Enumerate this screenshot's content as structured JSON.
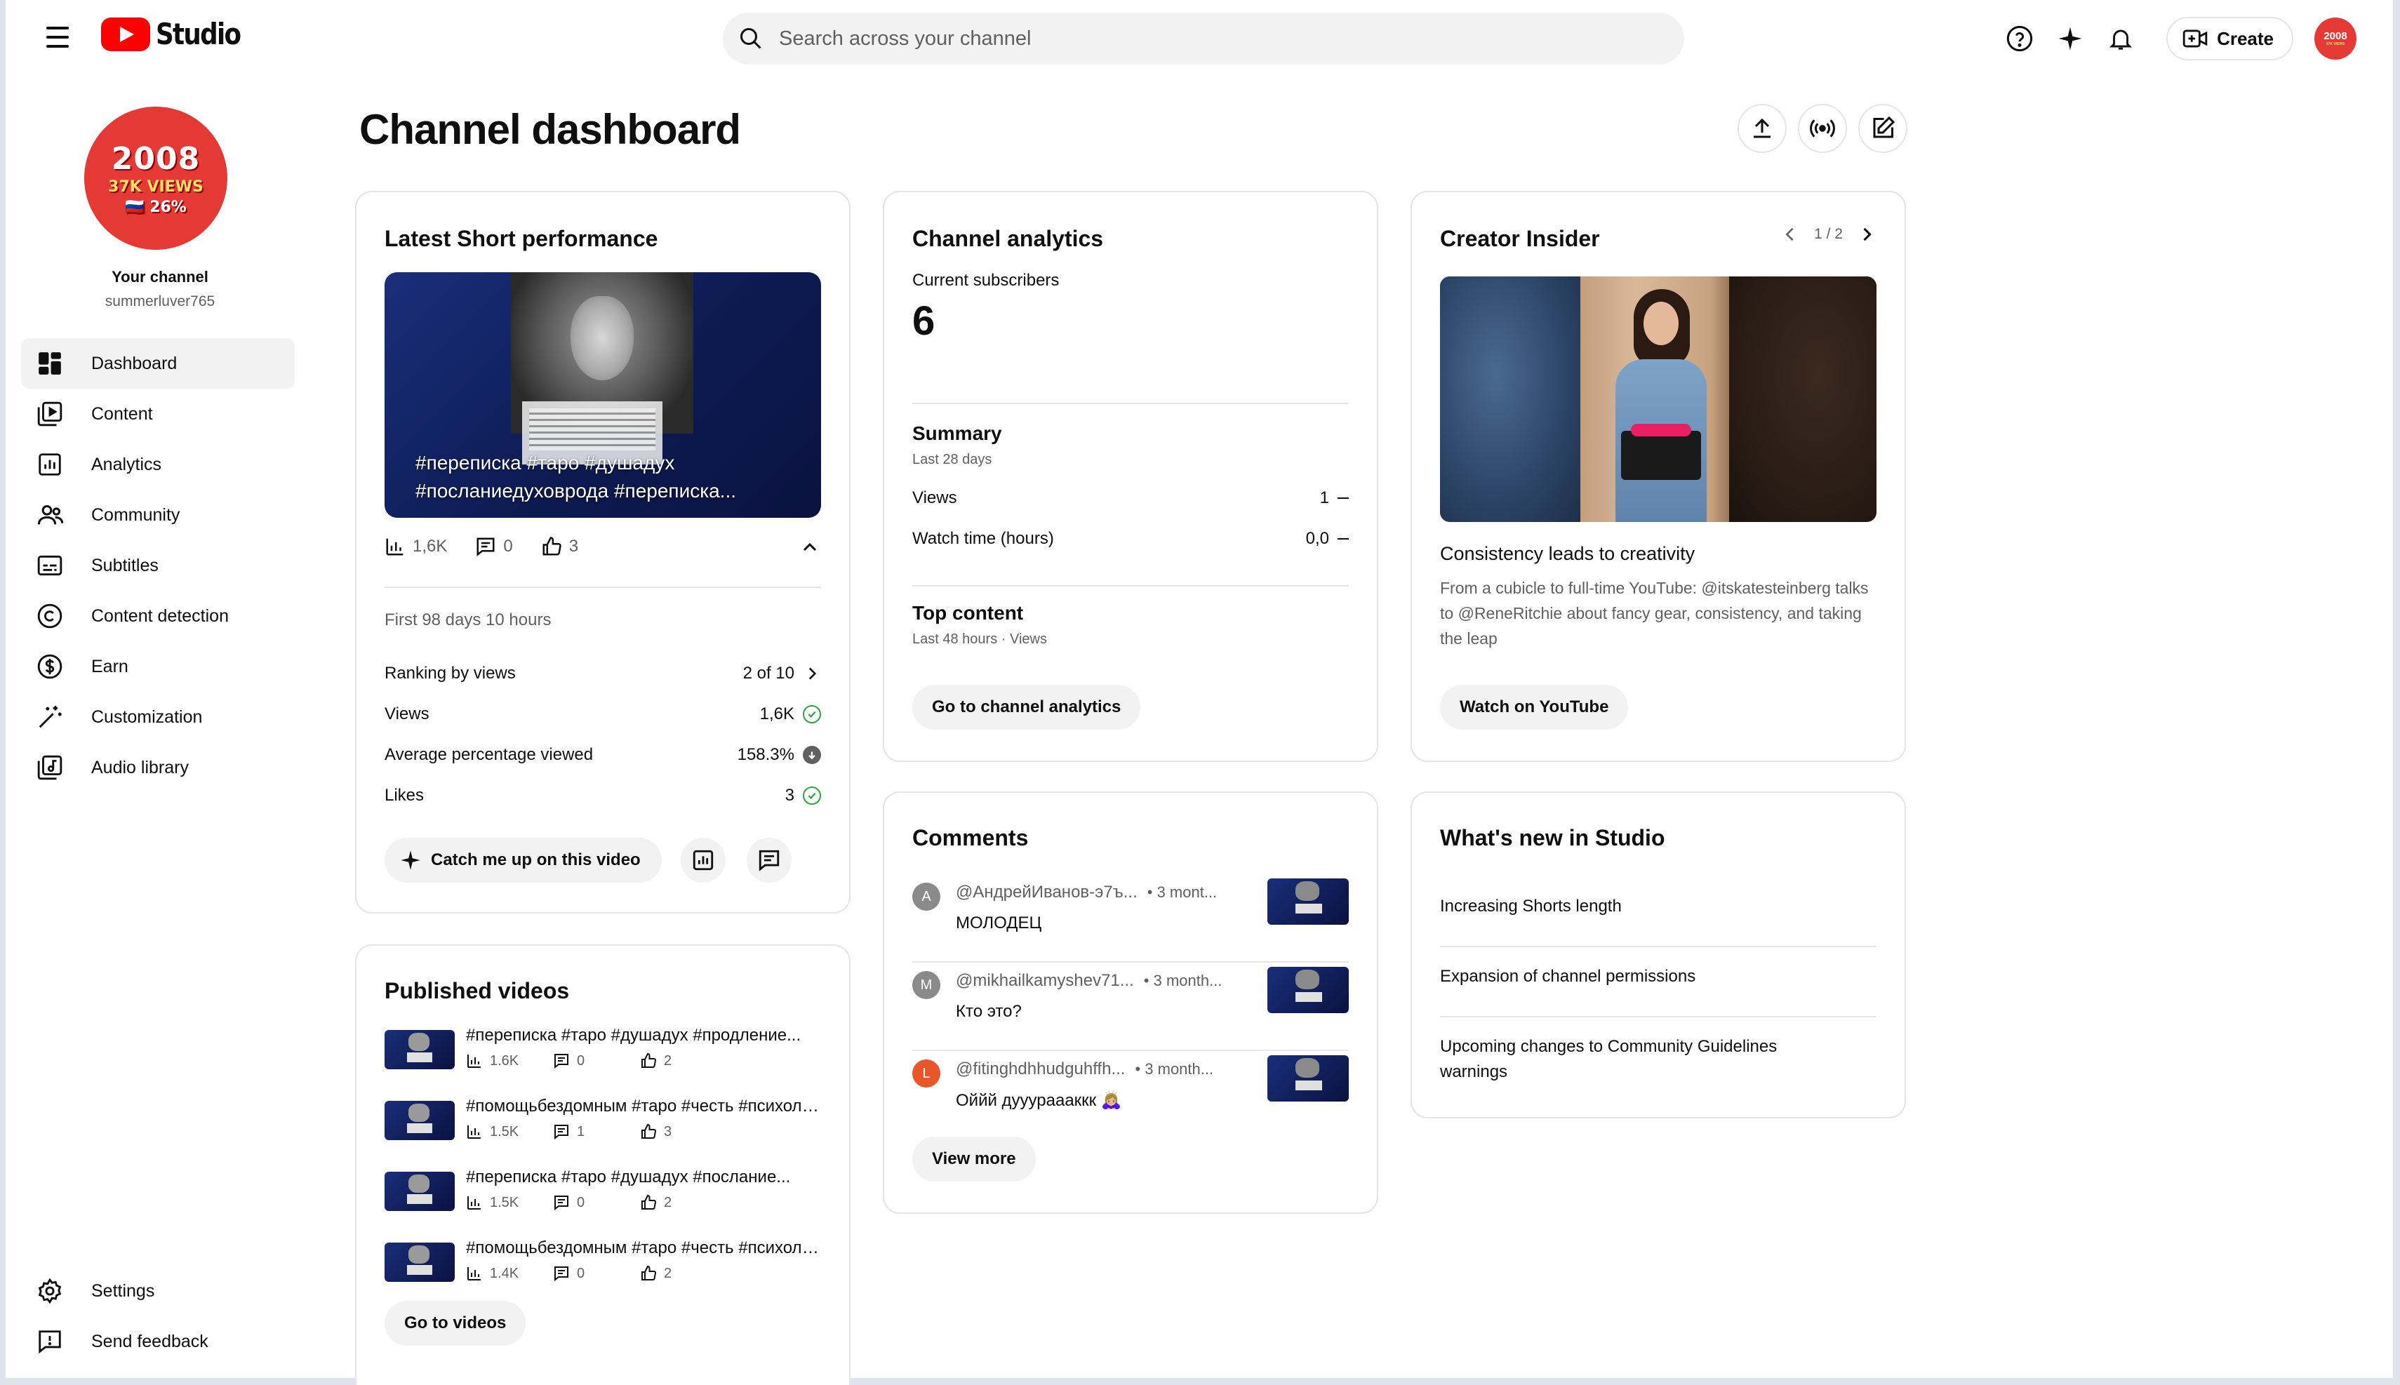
{
  "app": {
    "logo_text": "Studio",
    "search_placeholder": "Search across your channel",
    "create_label": "Create"
  },
  "avatar": {
    "line1": "2008",
    "line2": "37K VIEWS",
    "line3": "🇷🇺 26%"
  },
  "channel": {
    "label": "Your channel",
    "handle": "summerluver765"
  },
  "sidebar": {
    "items": [
      {
        "label": "Dashboard",
        "icon": "dashboard-icon",
        "active": true
      },
      {
        "label": "Content",
        "icon": "content-icon"
      },
      {
        "label": "Analytics",
        "icon": "analytics-icon"
      },
      {
        "label": "Community",
        "icon": "community-icon"
      },
      {
        "label": "Subtitles",
        "icon": "subtitles-icon"
      },
      {
        "label": "Content detection",
        "icon": "copyright-icon"
      },
      {
        "label": "Earn",
        "icon": "dollar-icon"
      },
      {
        "label": "Customization",
        "icon": "magic-wand-icon"
      },
      {
        "label": "Audio library",
        "icon": "audio-library-icon"
      }
    ],
    "bottom": [
      {
        "label": "Settings",
        "icon": "gear-icon"
      },
      {
        "label": "Send feedback",
        "icon": "feedback-icon"
      }
    ]
  },
  "page": {
    "title": "Channel dashboard"
  },
  "latest_short": {
    "title": "Latest Short performance",
    "thumb_caption_1": "#переписка #таро #душадух",
    "thumb_caption_2": "#посланиедуховрода #переписка...",
    "views": "1,6K",
    "comments": "0",
    "likes": "3",
    "period": "First 98 days 10 hours",
    "rows": [
      {
        "label": "Ranking by views",
        "value": "2 of 10"
      },
      {
        "label": "Views",
        "value": "1,6K"
      },
      {
        "label": "Average percentage viewed",
        "value": "158.3%"
      },
      {
        "label": "Likes",
        "value": "3"
      }
    ],
    "catch_up_label": "Catch me up on this video"
  },
  "published": {
    "title": "Published videos",
    "videos": [
      {
        "title": "#переписка #таро #душадух #продление...",
        "views": "1.6K",
        "comments": "0",
        "likes": "2"
      },
      {
        "title": "#помощьбездомным #таро #честь #психолог...",
        "views": "1.5K",
        "comments": "1",
        "likes": "3"
      },
      {
        "title": "#переписка #таро #душадух #послание...",
        "views": "1.5K",
        "comments": "0",
        "likes": "2"
      },
      {
        "title": "#помощьбездомным #таро #честь #психолог...",
        "views": "1.4K",
        "comments": "0",
        "likes": "2"
      }
    ],
    "button": "Go to videos"
  },
  "analytics": {
    "title": "Channel analytics",
    "subs_label": "Current subscribers",
    "subs_value": "6",
    "summary_title": "Summary",
    "summary_sub": "Last 28 days",
    "rows": [
      {
        "label": "Views",
        "value": "1"
      },
      {
        "label": "Watch time (hours)",
        "value": "0,0"
      }
    ],
    "top_title": "Top content",
    "top_sub": "Last 48 hours · Views",
    "button": "Go to channel analytics"
  },
  "comments": {
    "title": "Comments",
    "items": [
      {
        "initial": "А",
        "color": "#8a8a8a",
        "author": "@АндрейИванов-э7ъ...",
        "time": "• 3 mont...",
        "text": "МОЛОДЕЦ"
      },
      {
        "initial": "M",
        "color": "#8a8a8a",
        "author": "@mikhailkamyshev71...",
        "time": "• 3 month...",
        "text": "Кто это?"
      },
      {
        "initial": "L",
        "color": "#e8572a",
        "author": "@fitinghdhhudguhffh...",
        "time": "• 3 month...",
        "text": "Оййй дууураааккк 🙇🏼‍♀️"
      }
    ],
    "button": "View more"
  },
  "insider": {
    "title": "Creator Insider",
    "pager": "1 / 2",
    "video_title": "Consistency leads to creativity",
    "desc": "From a cubicle to full-time YouTube: @itskatesteinberg talks to @ReneRitchie about fancy gear, consistency, and taking the leap",
    "button": "Watch on YouTube"
  },
  "whats_new": {
    "title": "What's new in Studio",
    "items": [
      "Increasing Shorts length",
      "Expansion of channel permissions",
      "Upcoming changes to Community Guidelines warnings"
    ]
  },
  "colors": {
    "brand": "#ff0000",
    "avatar": "#e53935",
    "ok": "#2ba640"
  }
}
